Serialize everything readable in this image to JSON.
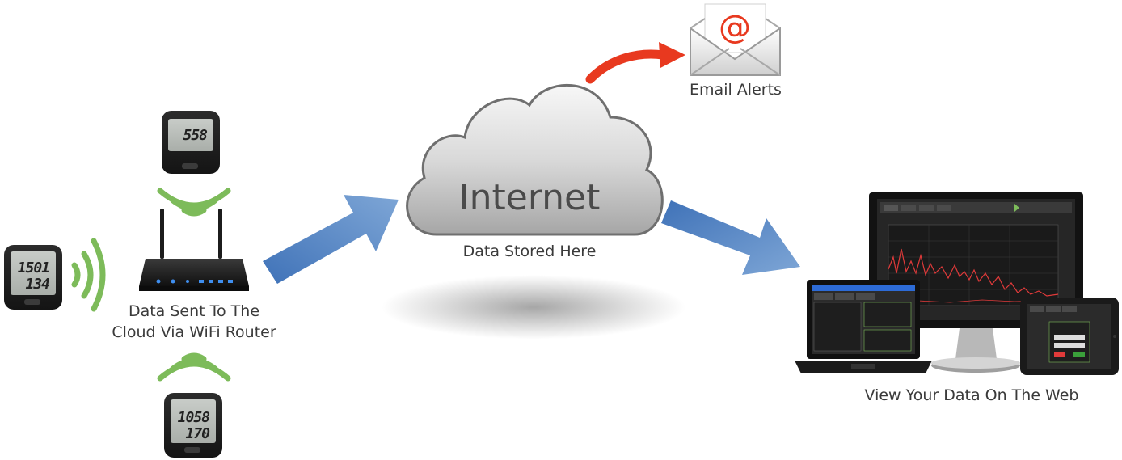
{
  "labels": {
    "email": "Email Alerts",
    "internet": "Internet",
    "stored": "Data Stored Here",
    "router_line1": "Data Sent To The",
    "router_line2": "Cloud Via WiFi Router",
    "web": "View Your Data On The Web"
  },
  "loggers": {
    "top": {
      "r1": "558"
    },
    "left": {
      "r1": "1501",
      "r2": "134"
    },
    "bottom": {
      "r1": "1058",
      "r2": "170"
    }
  },
  "colors": {
    "arrow_blue": "#4f7fbf",
    "alert_red": "#e8391f",
    "wifi_green": "#7dbb5a",
    "cloud_gray": "#9a9a9a"
  },
  "icons": [
    "logger-device",
    "wifi-router",
    "wifi-signal",
    "cloud",
    "email-envelope",
    "monitor",
    "laptop",
    "tablet"
  ]
}
